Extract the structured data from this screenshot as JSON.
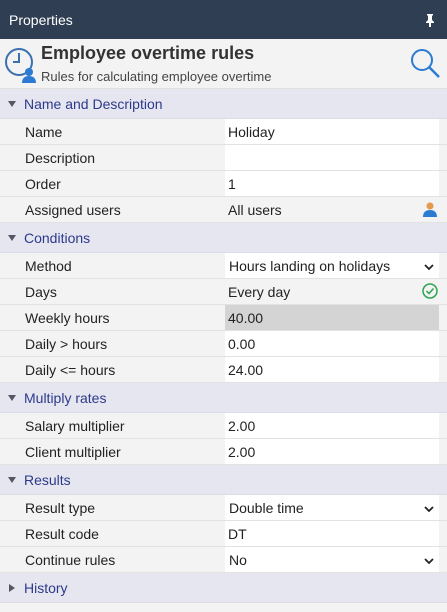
{
  "window": {
    "title": "Properties"
  },
  "header": {
    "title": "Employee overtime rules",
    "subtitle": "Rules for calculating employee overtime"
  },
  "sections": {
    "name_desc": {
      "label": "Name and Description"
    },
    "conditions": {
      "label": "Conditions"
    },
    "multiply": {
      "label": "Multiply rates"
    },
    "results": {
      "label": "Results"
    },
    "history": {
      "label": "History"
    }
  },
  "fields": {
    "name": {
      "label": "Name",
      "value": "Holiday"
    },
    "description": {
      "label": "Description",
      "value": ""
    },
    "order": {
      "label": "Order",
      "value": "1"
    },
    "assigned_users": {
      "label": "Assigned users",
      "value": "All users"
    },
    "method": {
      "label": "Method",
      "value": "Hours landing on holidays"
    },
    "days": {
      "label": "Days",
      "value": "Every day"
    },
    "weekly_hours": {
      "label": "Weekly hours",
      "value": "40.00"
    },
    "daily_gt": {
      "label": "Daily > hours",
      "value": "0.00"
    },
    "daily_le": {
      "label": "Daily <= hours",
      "value": "24.00"
    },
    "salary_mult": {
      "label": "Salary multiplier",
      "value": "2.00"
    },
    "client_mult": {
      "label": "Client multiplier",
      "value": "2.00"
    },
    "result_type": {
      "label": "Result type",
      "value": "Double time"
    },
    "result_code": {
      "label": "Result code",
      "value": "DT"
    },
    "continue_rules": {
      "label": "Continue rules",
      "value": "No"
    }
  },
  "icons": {
    "pin": "pin-icon",
    "clock_user": "clock-user-icon",
    "search": "search-icon",
    "user": "user-icon",
    "check": "check-circle-icon",
    "chevron_down": "chevron-down-icon",
    "chevron_right": "chevron-right-icon"
  },
  "colors": {
    "titlebar": "#2f3e52",
    "section_bg": "#e6e6f0",
    "section_text": "#2c3a8a",
    "accent": "#2a7bd1",
    "check": "#2ea44f"
  }
}
